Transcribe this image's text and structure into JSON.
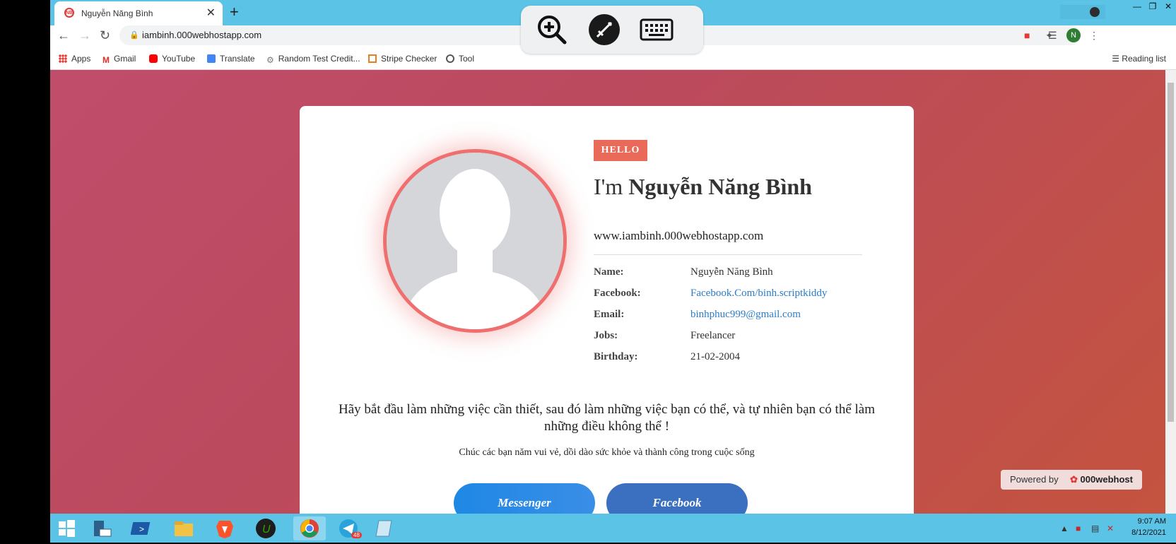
{
  "browser": {
    "tab": {
      "title": "Nguyễn Năng Bình",
      "favicon": "NB",
      "close": "✕"
    },
    "new_tab": "+",
    "url": "iambinh.000webhostapp.com",
    "profile_initial": "N",
    "bookmarks": [
      {
        "label": "Apps",
        "icon": "apps-icon"
      },
      {
        "label": "Gmail",
        "icon": "gmail-icon"
      },
      {
        "label": "YouTube",
        "icon": "youtube-icon"
      },
      {
        "label": "Translate",
        "icon": "translate-icon"
      },
      {
        "label": "Random Test Credit...",
        "icon": "gear-icon"
      },
      {
        "label": "Stripe Checker",
        "icon": "stripe-icon"
      },
      {
        "label": "Tool",
        "icon": "globe-icon"
      }
    ],
    "reading_list": "Reading list"
  },
  "profile": {
    "badge": "HELLO",
    "greeting_prefix": "I'm ",
    "name_heading": "Nguyễn Năng Bình",
    "site": "www.iambinh.000webhostapp.com",
    "info": [
      {
        "label": "Name:",
        "value": "Nguyễn Năng Bình",
        "link": false
      },
      {
        "label": "Facebook:",
        "value": "Facebook.Com/binh.scriptkiddy",
        "link": true
      },
      {
        "label": "Email:",
        "value": "binhphuc999@gmail.com",
        "link": true
      },
      {
        "label": "Jobs:",
        "value": "Freelancer",
        "link": false
      },
      {
        "label": "Birthday:",
        "value": "21-02-2004",
        "link": false
      }
    ],
    "quote": "Hãy bắt đầu làm những việc cần thiết, sau đó làm những việc bạn có thể, và tự nhiên bạn có thể làm những điều không thể !",
    "wish": "Chúc các bạn năm vui vẻ, dồi dào sức khỏe và thành công trong cuộc sống",
    "buttons": {
      "messenger": "Messenger",
      "facebook": "Facebook"
    }
  },
  "powered": {
    "text": "Powered by",
    "brand": "000webhost"
  },
  "taskbar": {
    "time": "9:07 AM",
    "date": "8/12/2021",
    "telegram_badge": "48"
  },
  "colors": {
    "accent": "#ef6f6f",
    "hello_bg": "#e96a58",
    "link": "#2a7ccb",
    "chrome_bar": "#5bc4e6"
  }
}
